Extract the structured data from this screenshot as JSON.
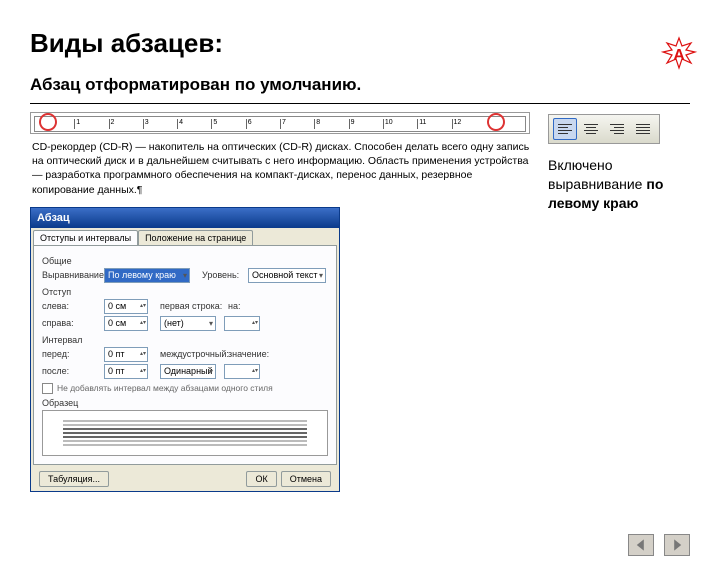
{
  "title": "Виды абзацев:",
  "subtitle": "Абзац отформатирован по умолчанию.",
  "doc_text": "CD-рекордер (CD-R) — накопитель на оптических (CD-R) дисках. Способен делать всего одну запись на оптический диск и в дальнейшем считывать с него информацию. Область применения устройства — разработка программного обеспечения на компакт-дисках, перенос данных, резервное копирование данных.¶",
  "ruler_ticks": [
    "1",
    "2",
    "3",
    "4",
    "5",
    "6",
    "7",
    "8",
    "9",
    "10",
    "11",
    "12"
  ],
  "dialog": {
    "title": "Абзац",
    "tabs": [
      "Отступы и интервалы",
      "Положение на странице"
    ],
    "groups": {
      "general": "Общие",
      "indent": "Отступ",
      "spacing": "Интервал",
      "sample": "Образец"
    },
    "fields": {
      "align_label": "Выравнивание:",
      "align_value": "По левому краю",
      "level_label": "Уровень:",
      "level_value": "Основной текст",
      "left_label": "слева:",
      "left_value": "0 см",
      "right_label": "справа:",
      "right_value": "0 см",
      "first_label": "первая строка:",
      "first_value": "(нет)",
      "by1_label": "на:",
      "by1_value": "",
      "before_label": "перед:",
      "before_value": "0 пт",
      "after_label": "после:",
      "after_value": "0 пт",
      "line_label": "междустрочный:",
      "line_value": "Одинарный",
      "by2_label": "значение:",
      "by2_value": "",
      "checkbox": "Не добавлять интервал между абзацами одного стиля"
    },
    "buttons": {
      "tabs": "Табуляция...",
      "ok": "ОК",
      "cancel": "Отмена"
    }
  },
  "align_buttons": [
    "align-left",
    "align-center",
    "align-right",
    "align-justify"
  ],
  "caption": {
    "line1": "Включено",
    "line2": "выравнивание ",
    "line3_bold": "по левому краю"
  },
  "nav": {
    "prev": "prev",
    "next": "next"
  }
}
